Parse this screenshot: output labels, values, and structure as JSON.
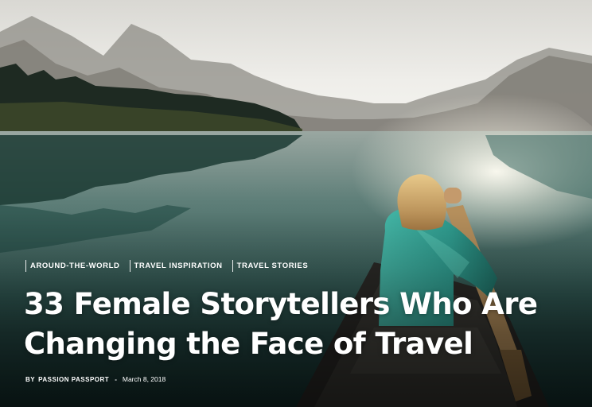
{
  "article": {
    "categories": [
      {
        "label": "AROUND-THE-WORLD"
      },
      {
        "label": "TRAVEL INSPIRATION"
      },
      {
        "label": "TRAVEL STORIES"
      }
    ],
    "title_line1": "33 Female Storytellers Who Are",
    "title_line2": "Changing the Face of Travel",
    "byline": {
      "by": "BY",
      "author": "PASSION PASSPORT",
      "separator": "-",
      "date": "March 8, 2018"
    }
  },
  "hero_image": {
    "subject": "woman-paddling-canoe-on-mountain-lake",
    "colors": {
      "sky": "#e9eae6",
      "mountain": "#6f716b",
      "forest": "#1e2a22",
      "lake": "#2e5c56",
      "jacket": "#2f9c8f",
      "canoe": "#2b2a27"
    }
  }
}
